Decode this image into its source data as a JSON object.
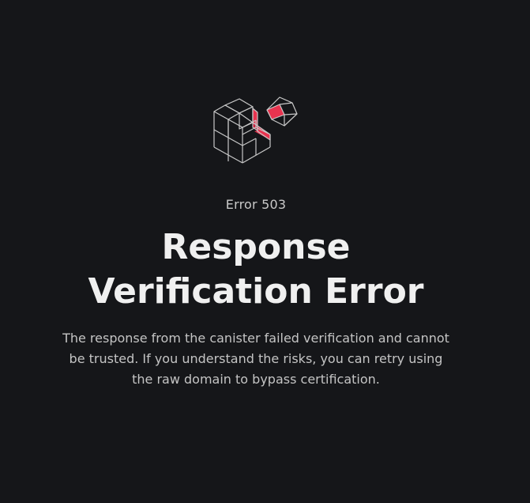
{
  "error": {
    "code_label": "Error 503",
    "title": "Response Verification Error",
    "description": "The response from the canister failed verification and cannot be trusted. If you understand the risks, you can retry using the raw domain to bypass certification."
  },
  "colors": {
    "background": "#151619",
    "accent": "#e8334f",
    "outline": "#c8c8c8"
  },
  "icons": {
    "logo": "stacked-cubes-icon"
  }
}
